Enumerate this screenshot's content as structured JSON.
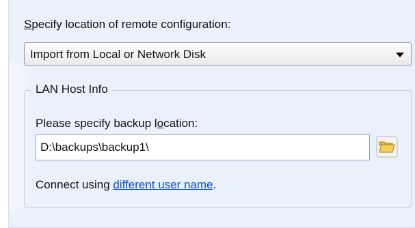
{
  "spec": {
    "label_first": "S",
    "label_rest": "pecify location of remote configuration:"
  },
  "dropdown": {
    "selected": "Import from Local or Network Disk",
    "icon": "chevron-down-icon"
  },
  "lan_group": {
    "title": "LAN Host Info",
    "backup_label_pre": "Please specify backup l",
    "backup_label_ul": "o",
    "backup_label_post": "cation:",
    "path_value": "D:\\backups\\backup1\\",
    "browse_icon": "folder-open-icon",
    "connect_pre": "Connect using ",
    "connect_link": "different user name",
    "connect_post": "."
  },
  "colors": {
    "panel_bg": "#eaf1fb",
    "link": "#0b4fd1",
    "folder": "#f0c048"
  }
}
